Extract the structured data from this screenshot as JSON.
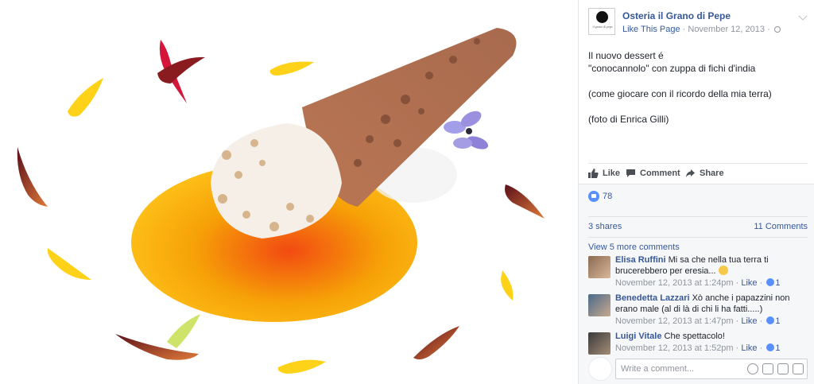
{
  "post": {
    "page_name": "Osteria il Grano di Pepe",
    "avatar_text": "il grano di pepe",
    "like_page": "Like This Page",
    "date": "November 12, 2013",
    "text_lines": [
      "Il nuovo dessert é\n\"conocannolo\" con zuppa di fichi d'india",
      "(come giocare con il ricordo della mia terra)",
      "(foto di Enrica Gilli)"
    ]
  },
  "actions": {
    "like": "Like",
    "comment": "Comment",
    "share": "Share"
  },
  "stats": {
    "likes": "78",
    "shares": "3 shares",
    "comments": "11 Comments",
    "view_more": "View 5 more comments"
  },
  "comments": [
    {
      "author": "Elisa Ruffini",
      "text": "Mi sa che nella tua terra ti brucerebbero per eresia...",
      "date": "November 12, 2013 at 1:24pm",
      "like": "Like",
      "likes": "1"
    },
    {
      "author": "Benedetta Lazzari",
      "text": "Xò anche i papazzini non erano male (al di là di chi li ha fatti.....)",
      "date": "November 12, 2013 at 1:47pm",
      "like": "Like",
      "likes": "1"
    },
    {
      "author": "Luigi Vitale",
      "text": "Che spettacolo!",
      "date": "November 12, 2013 at 1:52pm",
      "like": "Like",
      "likes": "1"
    }
  ],
  "composer": {
    "placeholder": "Write a comment..."
  },
  "colors": {
    "link": "#365899",
    "meta": "#90949c",
    "like_blue": "#5890ff",
    "sauce_orange": "#f5a100"
  },
  "icons": [
    "globe-icon",
    "chevron-down-icon",
    "thumbs-up-icon",
    "comment-icon",
    "share-icon",
    "emoji-icon",
    "camera-icon",
    "gif-icon",
    "sticker-icon"
  ]
}
